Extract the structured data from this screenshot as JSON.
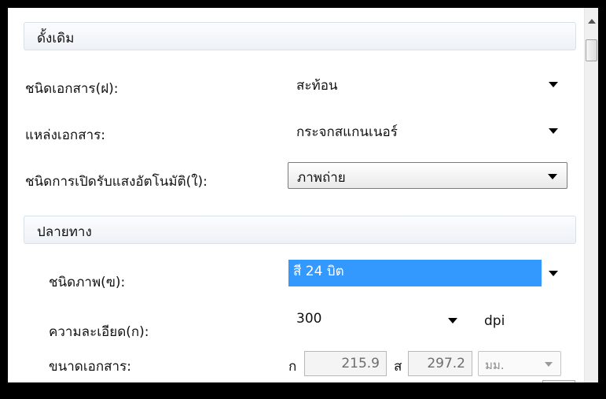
{
  "sections": {
    "original": {
      "title": "ดั้งเดิม"
    },
    "destination": {
      "title": "ปลายทาง"
    }
  },
  "original": {
    "document_type": {
      "label": "ชนิดเอกสาร(ฝ):",
      "value": "สะท้อน"
    },
    "document_source": {
      "label": "แหล่งเอกสาร:",
      "value": "กระจกสแกนเนอร์"
    },
    "auto_exposure": {
      "label": "ชนิดการเปิดรับแสงอัตโนมัติ(ใ):",
      "value": "ภาพถ่าย"
    }
  },
  "destination": {
    "image_type": {
      "label": "ชนิดภาพ(ฃ):",
      "value": "สี 24 บิต"
    },
    "resolution": {
      "label": "ความละเอียด(ก):",
      "value": "300",
      "unit": "dpi"
    },
    "document_size": {
      "label": "ขนาดเอกสาร:",
      "width_label": "ก",
      "width_value": "215.9",
      "height_label": "ส",
      "height_value": "297.2",
      "unit_value": "มม."
    }
  },
  "colors": {
    "selection": "#3399ff",
    "section_border": "#d8e1ea"
  }
}
